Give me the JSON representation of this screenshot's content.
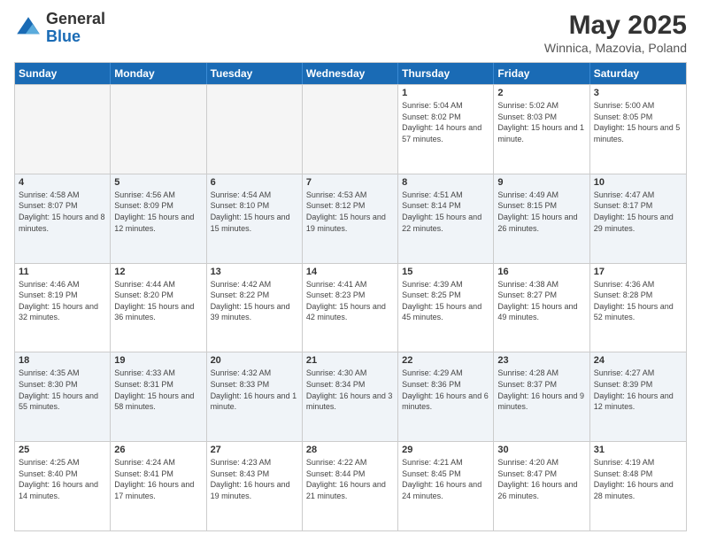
{
  "logo": {
    "general": "General",
    "blue": "Blue"
  },
  "title": "May 2025",
  "subtitle": "Winnica, Mazovia, Poland",
  "weekdays": [
    "Sunday",
    "Monday",
    "Tuesday",
    "Wednesday",
    "Thursday",
    "Friday",
    "Saturday"
  ],
  "weeks": [
    [
      {
        "day": "",
        "info": "",
        "empty": true
      },
      {
        "day": "",
        "info": "",
        "empty": true
      },
      {
        "day": "",
        "info": "",
        "empty": true
      },
      {
        "day": "",
        "info": "",
        "empty": true
      },
      {
        "day": "1",
        "info": "Sunrise: 5:04 AM\nSunset: 8:02 PM\nDaylight: 14 hours\nand 57 minutes."
      },
      {
        "day": "2",
        "info": "Sunrise: 5:02 AM\nSunset: 8:03 PM\nDaylight: 15 hours\nand 1 minute."
      },
      {
        "day": "3",
        "info": "Sunrise: 5:00 AM\nSunset: 8:05 PM\nDaylight: 15 hours\nand 5 minutes."
      }
    ],
    [
      {
        "day": "4",
        "info": "Sunrise: 4:58 AM\nSunset: 8:07 PM\nDaylight: 15 hours\nand 8 minutes."
      },
      {
        "day": "5",
        "info": "Sunrise: 4:56 AM\nSunset: 8:09 PM\nDaylight: 15 hours\nand 12 minutes."
      },
      {
        "day": "6",
        "info": "Sunrise: 4:54 AM\nSunset: 8:10 PM\nDaylight: 15 hours\nand 15 minutes."
      },
      {
        "day": "7",
        "info": "Sunrise: 4:53 AM\nSunset: 8:12 PM\nDaylight: 15 hours\nand 19 minutes."
      },
      {
        "day": "8",
        "info": "Sunrise: 4:51 AM\nSunset: 8:14 PM\nDaylight: 15 hours\nand 22 minutes."
      },
      {
        "day": "9",
        "info": "Sunrise: 4:49 AM\nSunset: 8:15 PM\nDaylight: 15 hours\nand 26 minutes."
      },
      {
        "day": "10",
        "info": "Sunrise: 4:47 AM\nSunset: 8:17 PM\nDaylight: 15 hours\nand 29 minutes."
      }
    ],
    [
      {
        "day": "11",
        "info": "Sunrise: 4:46 AM\nSunset: 8:19 PM\nDaylight: 15 hours\nand 32 minutes."
      },
      {
        "day": "12",
        "info": "Sunrise: 4:44 AM\nSunset: 8:20 PM\nDaylight: 15 hours\nand 36 minutes."
      },
      {
        "day": "13",
        "info": "Sunrise: 4:42 AM\nSunset: 8:22 PM\nDaylight: 15 hours\nand 39 minutes."
      },
      {
        "day": "14",
        "info": "Sunrise: 4:41 AM\nSunset: 8:23 PM\nDaylight: 15 hours\nand 42 minutes."
      },
      {
        "day": "15",
        "info": "Sunrise: 4:39 AM\nSunset: 8:25 PM\nDaylight: 15 hours\nand 45 minutes."
      },
      {
        "day": "16",
        "info": "Sunrise: 4:38 AM\nSunset: 8:27 PM\nDaylight: 15 hours\nand 49 minutes."
      },
      {
        "day": "17",
        "info": "Sunrise: 4:36 AM\nSunset: 8:28 PM\nDaylight: 15 hours\nand 52 minutes."
      }
    ],
    [
      {
        "day": "18",
        "info": "Sunrise: 4:35 AM\nSunset: 8:30 PM\nDaylight: 15 hours\nand 55 minutes."
      },
      {
        "day": "19",
        "info": "Sunrise: 4:33 AM\nSunset: 8:31 PM\nDaylight: 15 hours\nand 58 minutes."
      },
      {
        "day": "20",
        "info": "Sunrise: 4:32 AM\nSunset: 8:33 PM\nDaylight: 16 hours\nand 1 minute."
      },
      {
        "day": "21",
        "info": "Sunrise: 4:30 AM\nSunset: 8:34 PM\nDaylight: 16 hours\nand 3 minutes."
      },
      {
        "day": "22",
        "info": "Sunrise: 4:29 AM\nSunset: 8:36 PM\nDaylight: 16 hours\nand 6 minutes."
      },
      {
        "day": "23",
        "info": "Sunrise: 4:28 AM\nSunset: 8:37 PM\nDaylight: 16 hours\nand 9 minutes."
      },
      {
        "day": "24",
        "info": "Sunrise: 4:27 AM\nSunset: 8:39 PM\nDaylight: 16 hours\nand 12 minutes."
      }
    ],
    [
      {
        "day": "25",
        "info": "Sunrise: 4:25 AM\nSunset: 8:40 PM\nDaylight: 16 hours\nand 14 minutes."
      },
      {
        "day": "26",
        "info": "Sunrise: 4:24 AM\nSunset: 8:41 PM\nDaylight: 16 hours\nand 17 minutes."
      },
      {
        "day": "27",
        "info": "Sunrise: 4:23 AM\nSunset: 8:43 PM\nDaylight: 16 hours\nand 19 minutes."
      },
      {
        "day": "28",
        "info": "Sunrise: 4:22 AM\nSunset: 8:44 PM\nDaylight: 16 hours\nand 21 minutes."
      },
      {
        "day": "29",
        "info": "Sunrise: 4:21 AM\nSunset: 8:45 PM\nDaylight: 16 hours\nand 24 minutes."
      },
      {
        "day": "30",
        "info": "Sunrise: 4:20 AM\nSunset: 8:47 PM\nDaylight: 16 hours\nand 26 minutes."
      },
      {
        "day": "31",
        "info": "Sunrise: 4:19 AM\nSunset: 8:48 PM\nDaylight: 16 hours\nand 28 minutes."
      }
    ]
  ]
}
